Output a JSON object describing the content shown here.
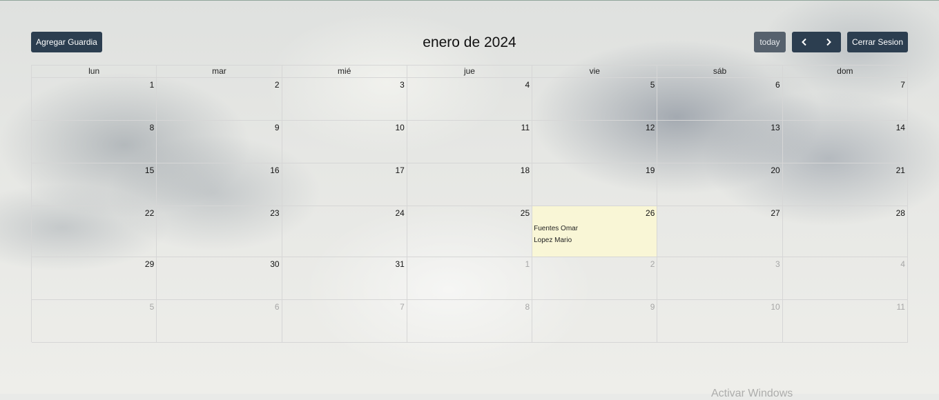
{
  "header": {
    "add_button": "Agregar Guardia",
    "title": "enero de 2024",
    "today_button": "today",
    "prev_icon": "chevron-left-icon",
    "next_icon": "chevron-right-icon",
    "logout_button": "Cerrar Sesion"
  },
  "calendar": {
    "weekdays": [
      "lun",
      "mar",
      "mié",
      "jue",
      "vie",
      "sáb",
      "dom"
    ],
    "weeks": [
      [
        "1",
        "2",
        "3",
        "4",
        "5",
        "6",
        "7"
      ],
      [
        "8",
        "9",
        "10",
        "11",
        "12",
        "13",
        "14"
      ],
      [
        "15",
        "16",
        "17",
        "18",
        "19",
        "20",
        "21"
      ],
      [
        "22",
        "23",
        "24",
        "25",
        "26",
        "27",
        "28"
      ],
      [
        "29",
        "30",
        "31",
        "1",
        "2",
        "3",
        "4"
      ],
      [
        "5",
        "6",
        "7",
        "8",
        "9",
        "10",
        "11"
      ]
    ],
    "today": "26",
    "events": {
      "26": [
        "Fuentes Omar",
        "Lopez Mario"
      ]
    }
  },
  "footer": {
    "watermark": "Activar Windows"
  },
  "colors": {
    "button": "#2c3e50",
    "button_disabled": "#56616d",
    "today_highlight": "#fcf8d2",
    "grid_border": "#d6d6d6"
  }
}
